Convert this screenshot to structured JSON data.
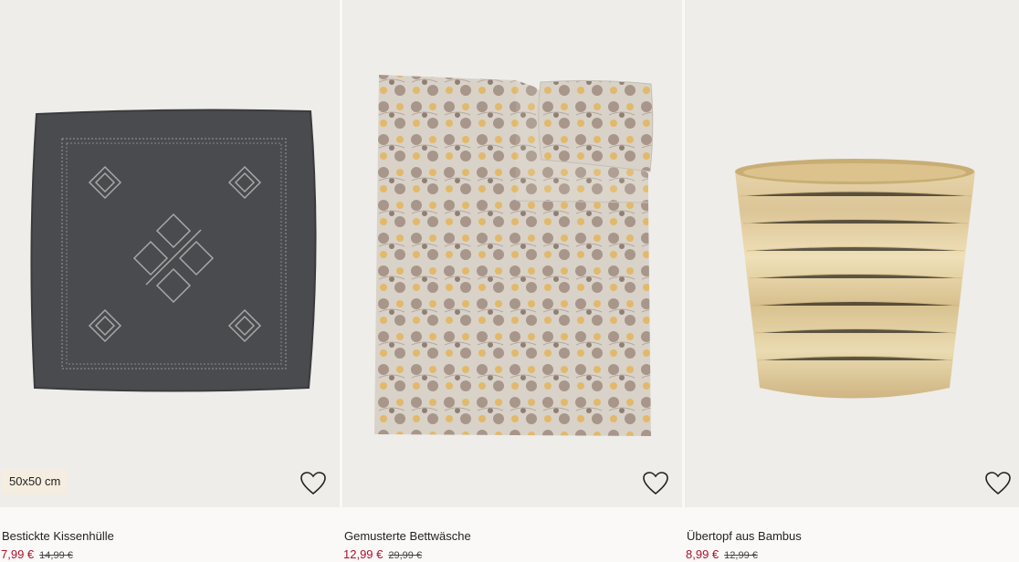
{
  "products": [
    {
      "image_alt": "pillow-cover",
      "badge": "50x50 cm",
      "title": "Bestickte Kissenhülle",
      "price": "7,99 €",
      "old_price": "14,99 €",
      "favorite_icon": "heart-outline-icon"
    },
    {
      "image_alt": "duvet-set",
      "title": "Gemusterte Bettwäsche",
      "price": "12,99 €",
      "old_price": "29,99 €",
      "favorite_icon": "heart-outline-icon"
    },
    {
      "image_alt": "bamboo-pot",
      "title": "Übertopf aus Bambus",
      "price": "8,99 €",
      "old_price": "12,99 €",
      "favorite_icon": "heart-outline-icon"
    }
  ],
  "colors": {
    "sale_price": "#b0112a",
    "badge_bg": "#f4ede0",
    "image_bg": "#eeedea"
  }
}
